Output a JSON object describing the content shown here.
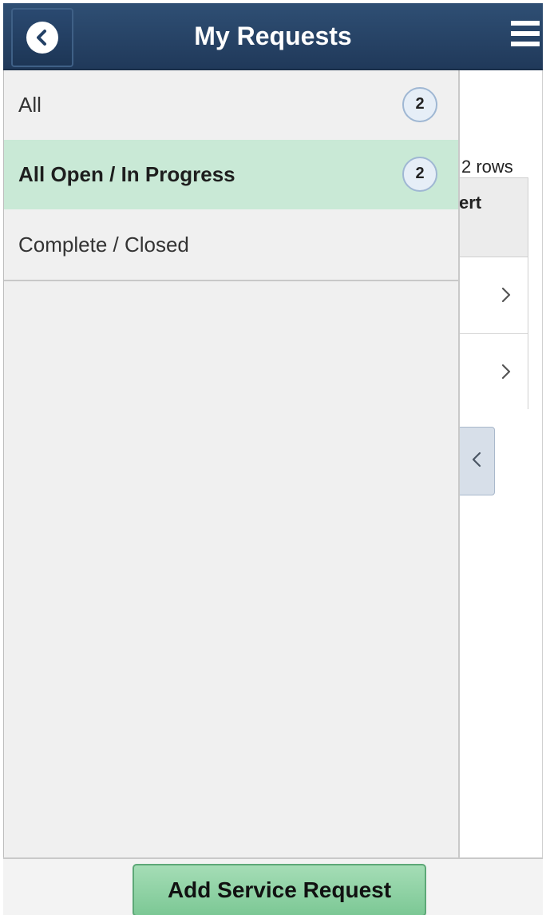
{
  "header": {
    "title": "My Requests"
  },
  "background": {
    "rows_text": "2 rows",
    "column_header_partial": "ert"
  },
  "panel": {
    "items": [
      {
        "label": "All",
        "count": "2"
      },
      {
        "label": "All Open / In Progress",
        "count": "2"
      },
      {
        "label": "Complete / Closed"
      }
    ]
  },
  "footer": {
    "add_button_label": "Add Service Request"
  },
  "colors": {
    "header": "#2f4f74",
    "selected_item": "#c9e9d6",
    "add_button": "#8fd1a4"
  },
  "icons": {
    "back": "chevron-left-circle-icon",
    "menu": "hamburger-menu-icon",
    "row_arrow": "chevron-right-icon",
    "collapse": "chevron-left-icon"
  }
}
